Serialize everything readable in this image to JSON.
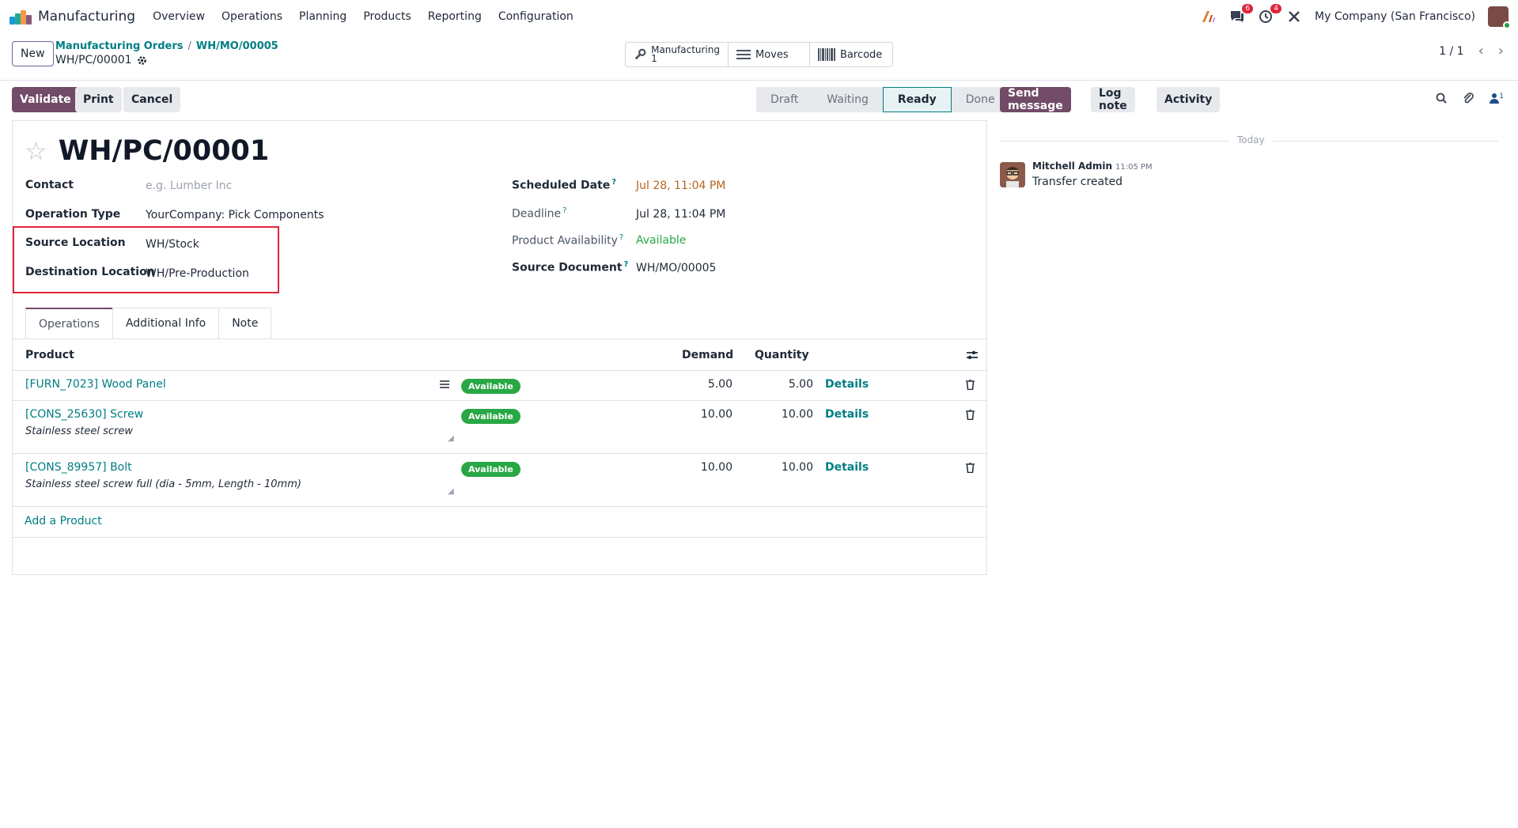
{
  "app": {
    "name": "Manufacturing",
    "menu": [
      "Overview",
      "Operations",
      "Planning",
      "Products",
      "Reporting",
      "Configuration"
    ],
    "messages_count": "6",
    "activities_count": "4",
    "company": "My Company (San Francisco)"
  },
  "control": {
    "new_label": "New",
    "breadcrumb": [
      "Manufacturing Orders",
      "WH/MO/00005"
    ],
    "record_name": "WH/PC/00001",
    "smart_buttons": {
      "manufacturing_label": "Manufacturing",
      "manufacturing_count": "1",
      "moves_label": "Moves",
      "barcode_label": "Barcode"
    },
    "pager": "1 / 1"
  },
  "actions": {
    "validate": "Validate",
    "print": "Print",
    "cancel": "Cancel"
  },
  "stages": [
    "Draft",
    "Waiting",
    "Ready",
    "Done"
  ],
  "active_stage": "Ready",
  "chatter_actions": {
    "send_message": "Send message",
    "log_note": "Log note",
    "activity": "Activity",
    "followers_count": "1"
  },
  "form": {
    "title": "WH/PC/00001",
    "contact_label": "Contact",
    "contact_placeholder": "e.g. Lumber Inc",
    "operation_type_label": "Operation Type",
    "operation_type_value": "YourCompany: Pick Components",
    "source_location_label": "Source Location",
    "source_location_value": "WH/Stock",
    "destination_location_label": "Destination Location",
    "destination_location_value": "WH/Pre-Production",
    "scheduled_date_label": "Scheduled Date",
    "scheduled_date_value": "Jul 28, 11:04 PM",
    "deadline_label": "Deadline",
    "deadline_value": "Jul 28, 11:04 PM",
    "availability_label": "Product Availability",
    "availability_value": "Available",
    "source_document_label": "Source Document",
    "source_document_value": "WH/MO/00005"
  },
  "tabs": [
    "Operations",
    "Additional Info",
    "Note"
  ],
  "table": {
    "headers": {
      "product": "Product",
      "demand": "Demand",
      "quantity": "Quantity"
    },
    "rows": [
      {
        "product": "[FURN_7023] Wood Panel",
        "description": "",
        "status": "Available",
        "demand": "5.00",
        "quantity": "5.00",
        "details": "Details"
      },
      {
        "product": "[CONS_25630] Screw",
        "description": "Stainless steel screw",
        "status": "Available",
        "demand": "10.00",
        "quantity": "10.00",
        "details": "Details"
      },
      {
        "product": "[CONS_89957] Bolt",
        "description": "Stainless steel screw full (dia - 5mm, Length - 10mm)",
        "status": "Available",
        "demand": "10.00",
        "quantity": "10.00",
        "details": "Details"
      }
    ],
    "add_product": "Add a Product"
  },
  "chatter": {
    "today": "Today",
    "author": "Mitchell Admin",
    "time": "11:05 PM",
    "body": "Transfer created"
  },
  "colors": {
    "primary": "#714b67",
    "link": "#017e84",
    "success": "#28a745",
    "highlight": "#e0263a"
  }
}
